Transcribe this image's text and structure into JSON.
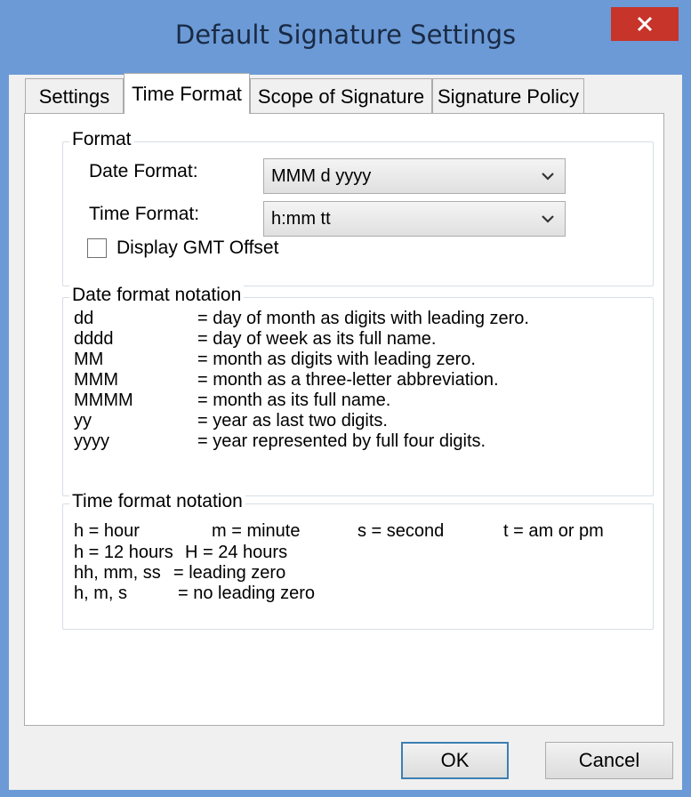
{
  "window": {
    "title": "Default Signature Settings",
    "close_icon": "close-icon",
    "accent": "#6b9ad6",
    "close_color": "#c7342a"
  },
  "tabs": [
    {
      "label": "Settings",
      "active": false
    },
    {
      "label": "Time Format",
      "active": true
    },
    {
      "label": "Scope of Signature",
      "active": false
    },
    {
      "label": "Signature Policy",
      "active": false
    }
  ],
  "format_group": {
    "title": "Format",
    "date_format_label": "Date Format:",
    "date_format_value": "MMM d yyyy",
    "time_format_label": "Time Format:",
    "time_format_value": "h:mm tt",
    "gmt_offset_label": "Display GMT Offset",
    "gmt_offset_checked": false
  },
  "date_notation": {
    "title": "Date format notation",
    "rows": [
      {
        "code": "dd",
        "desc": "= day of month as digits with leading zero."
      },
      {
        "code": "dddd",
        "desc": "= day of week as its full name."
      },
      {
        "code": "MM",
        "desc": "= month as digits with leading zero."
      },
      {
        "code": "MMM",
        "desc": "= month as a three-letter abbreviation."
      },
      {
        "code": "MMMM",
        "desc": "= month as its full name."
      },
      {
        "code": "yy",
        "desc": "= year as last two digits."
      },
      {
        "code": "yyyy",
        "desc": "= year represented by full four digits."
      }
    ]
  },
  "time_notation": {
    "title": "Time format notation",
    "hour": "h = hour",
    "minute": "m = minute",
    "second": "s = second",
    "ampm": "t = am or pm",
    "h12": "h = 12 hours",
    "h24": "H = 24 hours",
    "leading_codes": "hh, mm, ss",
    "leading_desc": "= leading zero",
    "noleading_codes": "h, m, s",
    "noleading_desc": "= no leading zero"
  },
  "buttons": {
    "ok": "OK",
    "cancel": "Cancel"
  }
}
